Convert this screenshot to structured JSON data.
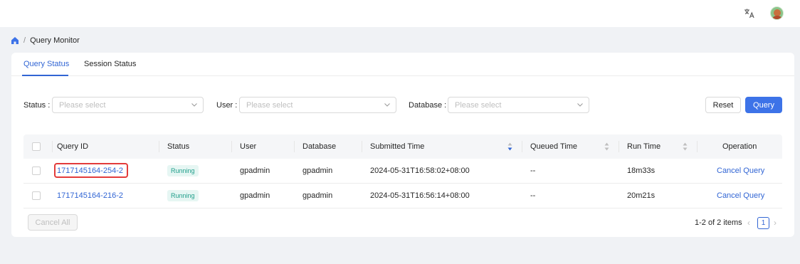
{
  "header": {
    "translate_icon": "translate-icon",
    "avatar_icon": "user-avatar"
  },
  "breadcrumb": {
    "home_icon": "home-icon",
    "separator": "/",
    "current": "Query Monitor"
  },
  "tabs": [
    {
      "label": "Query Status",
      "active": true
    },
    {
      "label": "Session Status",
      "active": false
    }
  ],
  "filters": {
    "status": {
      "label": "Status",
      "colon": ":",
      "placeholder": "Please select"
    },
    "user": {
      "label": "User",
      "colon": ":",
      "placeholder": "Please select"
    },
    "database": {
      "label": "Database",
      "colon": ":",
      "placeholder": "Please select"
    },
    "reset_label": "Reset",
    "query_label": "Query"
  },
  "table": {
    "columns": {
      "query_id": "Query ID",
      "status": "Status",
      "user": "User",
      "database": "Database",
      "submitted_time": "Submitted Time",
      "queued_time": "Queued Time",
      "run_time": "Run Time",
      "operation": "Operation"
    },
    "rows": [
      {
        "query_id": "1717145164-254-2",
        "status": "Running",
        "user": "gpadmin",
        "database": "gpadmin",
        "submitted_time": "2024-05-31T16:58:02+08:00",
        "queued_time": "--",
        "run_time": "18m33s",
        "operation": "Cancel Query",
        "highlighted": true
      },
      {
        "query_id": "1717145164-216-2",
        "status": "Running",
        "user": "gpadmin",
        "database": "gpadmin",
        "submitted_time": "2024-05-31T16:56:14+08:00",
        "queued_time": "--",
        "run_time": "20m21s",
        "operation": "Cancel Query",
        "highlighted": false
      }
    ]
  },
  "footer": {
    "cancel_all_label": "Cancel All",
    "pagination_text": "1-2 of 2 items",
    "current_page": "1",
    "prev_icon": "chevron-left-icon",
    "next_icon": "chevron-right-icon"
  },
  "colors": {
    "primary": "#3165d4",
    "badge_bg": "#e6f6f3",
    "badge_text": "#1f9e8a",
    "highlight_border": "#e33b3b"
  }
}
